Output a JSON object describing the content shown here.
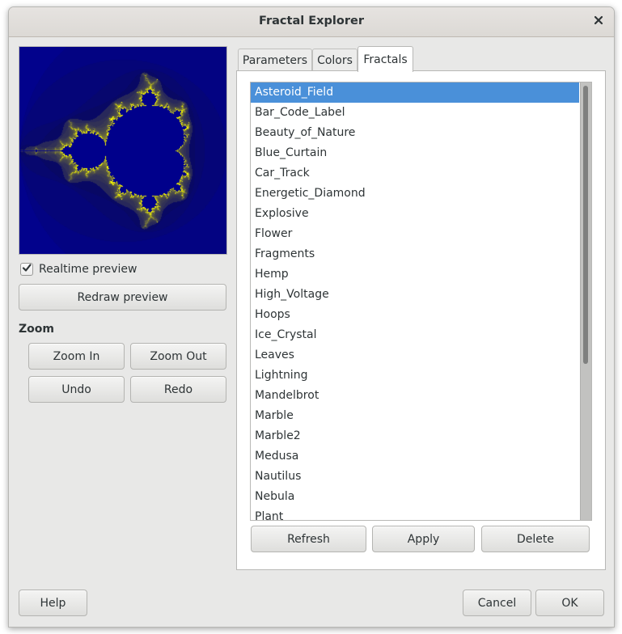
{
  "window": {
    "title": "Fractal Explorer",
    "close_icon": "close-icon"
  },
  "preview": {
    "fractal_type": "Mandelbrot",
    "colors": {
      "interior": "#00008b",
      "background": "#00008b",
      "edge": "#ffff00"
    },
    "realtime_preview": {
      "label": "Realtime preview",
      "checked": true
    },
    "redraw_label": "Redraw preview"
  },
  "zoom": {
    "heading": "Zoom",
    "zoom_in_label": "Zoom In",
    "zoom_out_label": "Zoom Out",
    "undo_label": "Undo",
    "redo_label": "Redo"
  },
  "tabs": [
    {
      "label": "Parameters",
      "active": false
    },
    {
      "label": "Colors",
      "active": false
    },
    {
      "label": "Fractals",
      "active": true
    }
  ],
  "fractals": {
    "selected": "Asteroid_Field",
    "items": [
      "Asteroid_Field",
      "Bar_Code_Label",
      "Beauty_of_Nature",
      "Blue_Curtain",
      "Car_Track",
      "Energetic_Diamond",
      "Explosive",
      "Flower",
      "Fragments",
      "Hemp",
      "High_Voltage",
      "Hoops",
      "Ice_Crystal",
      "Leaves",
      "Lightning",
      "Mandelbrot",
      "Marble",
      "Marble2",
      "Medusa",
      "Nautilus",
      "Nebula",
      "Plant"
    ],
    "scroll_position_fraction": 0.0,
    "refresh_label": "Refresh",
    "apply_label": "Apply",
    "delete_label": "Delete"
  },
  "footer": {
    "help_label": "Help",
    "cancel_label": "Cancel",
    "ok_label": "OK"
  },
  "accent_color": "#4a90d9"
}
